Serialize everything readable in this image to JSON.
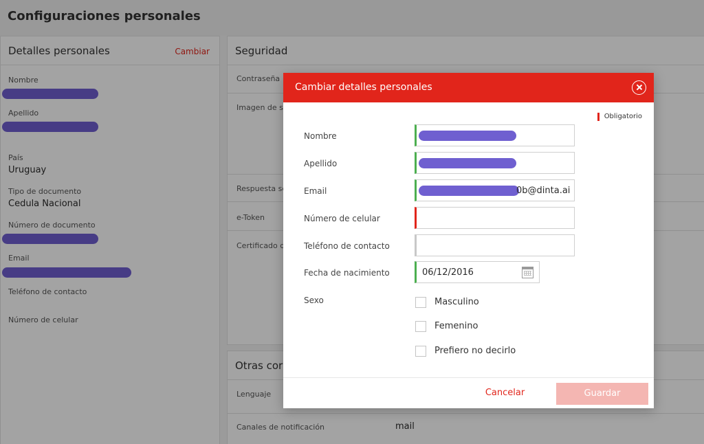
{
  "page": {
    "title": "Configuraciones personales"
  },
  "personal_panel": {
    "title": "Detalles personales",
    "change_link": "Cambiar",
    "fields": {
      "nombre_label": "Nombre",
      "apellido_label": "Apellido",
      "pais_label": "País",
      "pais_value": "Uruguay",
      "tipo_doc_label": "Tipo de documento",
      "tipo_doc_value": "Cedula Nacional",
      "num_doc_label": "Número de documento",
      "email_label": "Email",
      "telefono_label": "Teléfono de contacto",
      "celular_label": "Número de celular"
    }
  },
  "security_panel": {
    "title": "Seguridad",
    "rows": {
      "password": "Contraseña",
      "image": "Imagen de se",
      "answer": "Respuesta se",
      "etoken": "e-Token",
      "certificate": "Certificado d"
    }
  },
  "other_panel": {
    "title": "Otras cor",
    "rows": {
      "language": "Lenguaje",
      "channels_label": "Canales de notificación",
      "channels_value": "mail"
    }
  },
  "modal": {
    "title": "Cambiar detalles personales",
    "required_note": "Obligatorio",
    "labels": {
      "nombre": "Nombre",
      "apellido": "Apellido",
      "email": "Email",
      "celular": "Número de celular",
      "telefono": "Teléfono de contacto",
      "fecha": "Fecha de nacimiento",
      "sexo": "Sexo"
    },
    "values": {
      "email_suffix": "0b@dinta.ai",
      "celular": "",
      "telefono": "",
      "fecha": "06/12/2016"
    },
    "sex_options": [
      "Masculino",
      "Femenino",
      "Prefiero no decirlo"
    ],
    "cancel_label": "Cancelar",
    "save_label": "Guardar"
  },
  "colors": {
    "accent": "#e1251b",
    "valid": "#4caf50",
    "redaction": "#6f5fd0"
  },
  "icons": [
    "close-icon",
    "calendar-icon"
  ]
}
